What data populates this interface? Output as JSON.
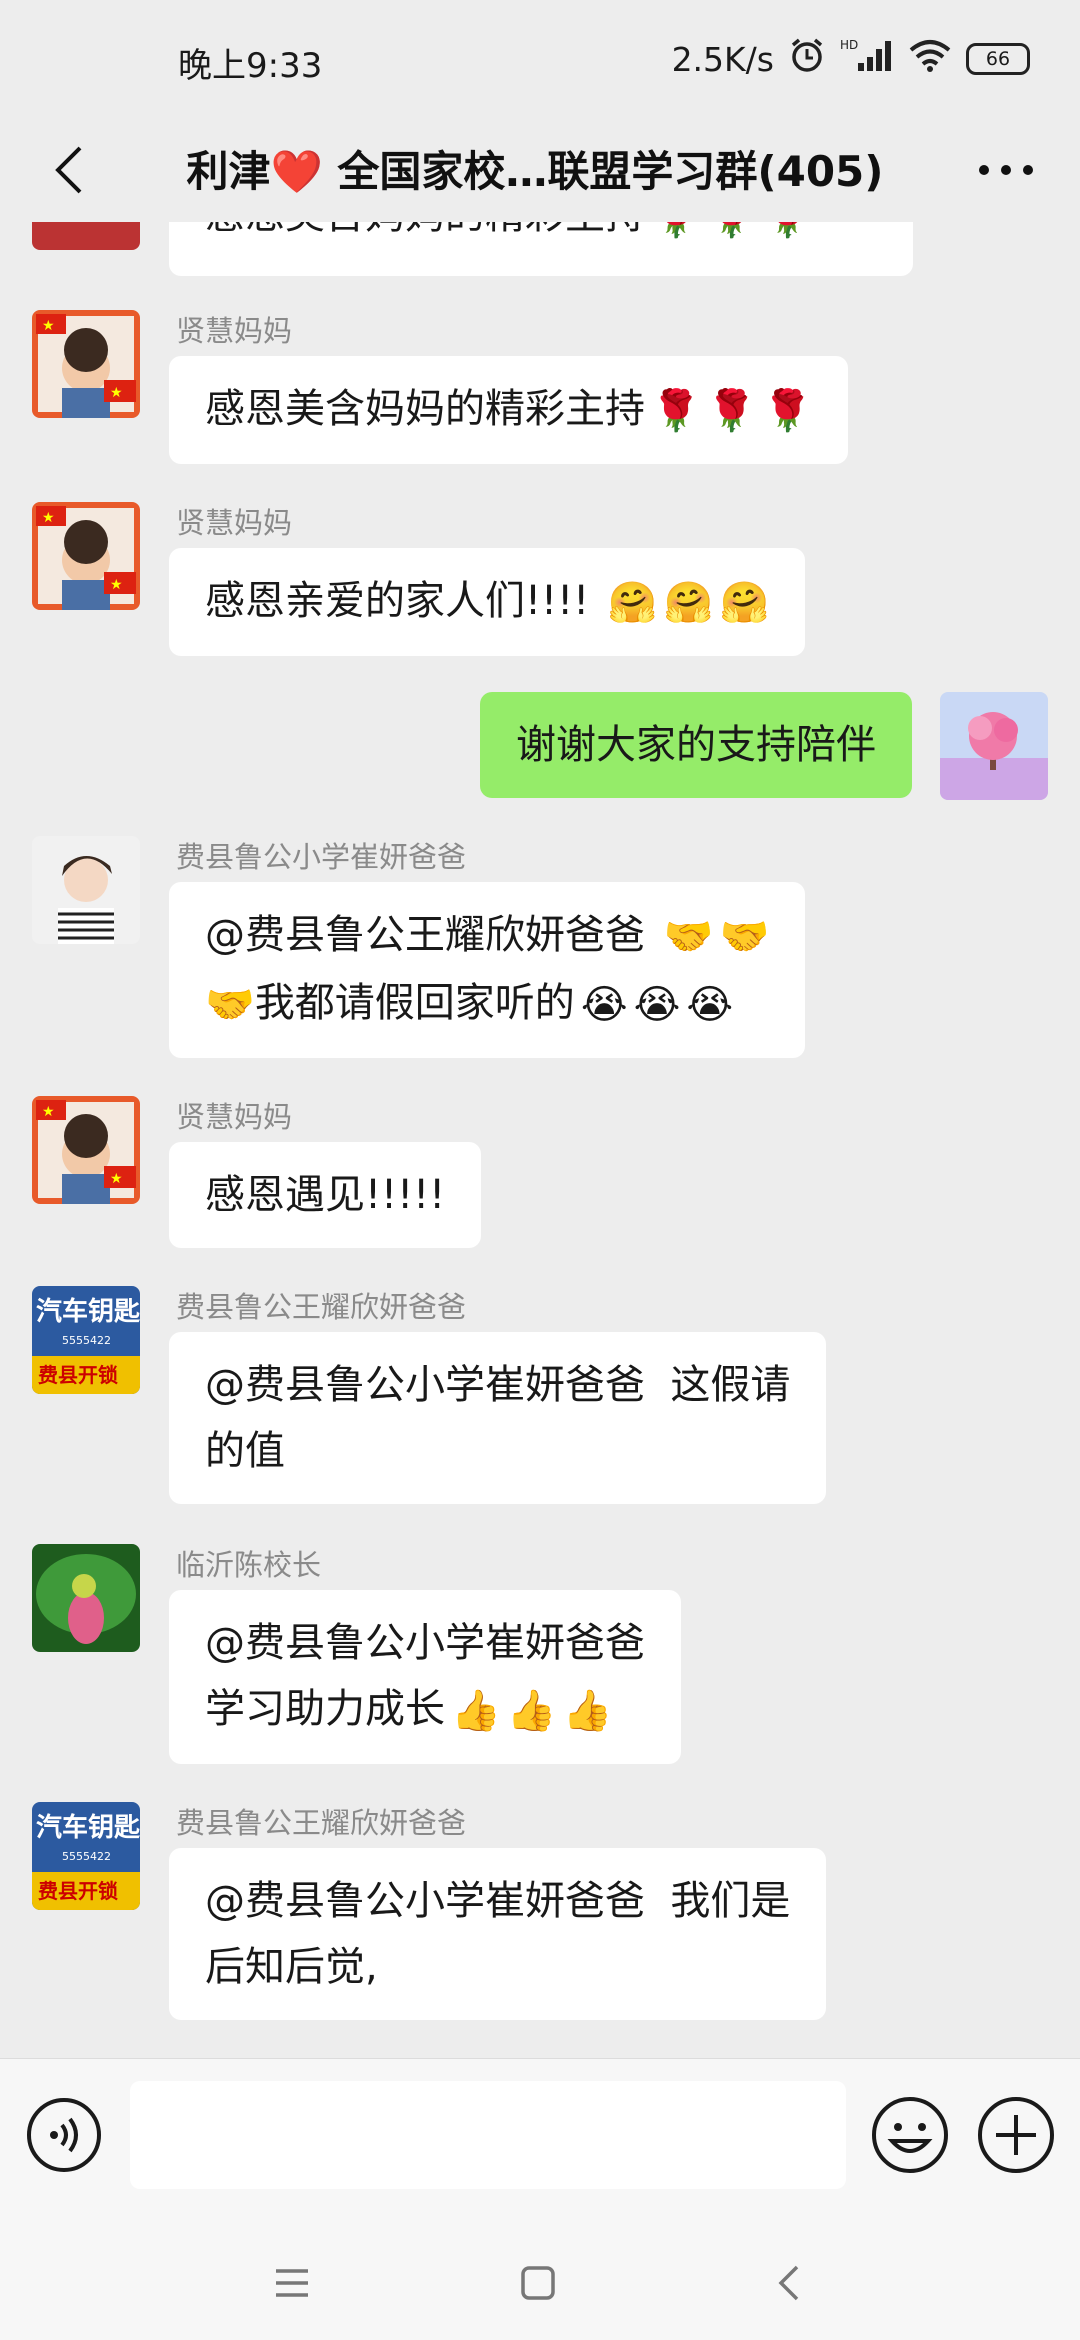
{
  "status_bar": {
    "time": "晚上9:33",
    "network_speed": "2.5K/s",
    "hd_label": "HD",
    "battery": "66"
  },
  "header": {
    "title": "利津❤️ 全国家校…联盟学习群(405)",
    "back_icon": "chevron-left-icon",
    "more_icon": "more-dots-icon"
  },
  "messages": [
    {
      "sender": "",
      "text": "感恩美含妈妈的精彩主持",
      "emojis": [
        "🌹",
        "🌹",
        "🌹"
      ],
      "side": "left",
      "partial": true
    },
    {
      "sender": "贤慧妈妈",
      "text": "感恩美含妈妈的精彩主持",
      "emojis": [
        "🌹",
        "🌹",
        "🌹"
      ],
      "side": "left"
    },
    {
      "sender": "贤慧妈妈",
      "text": "感恩亲爱的家人们!!!! ",
      "emojis": [
        "🤗",
        "🤗",
        "🤗"
      ],
      "side": "left"
    },
    {
      "sender": "",
      "text": "谢谢大家的支持陪伴",
      "emojis": [],
      "side": "right"
    },
    {
      "sender": "费县鲁公小学崔妍爸爸",
      "line1": "@费县鲁公王耀欣妍爸爸 ",
      "line1_emojis": [
        "🤝",
        "🤝"
      ],
      "line2_emojis_before": [
        "🤝"
      ],
      "line2": "我都请假回家听的",
      "line2_emojis": [
        "😭",
        "😭",
        "😭"
      ],
      "side": "left"
    },
    {
      "sender": "贤慧妈妈",
      "text": "感恩遇见!!!!!",
      "emojis": [],
      "side": "left"
    },
    {
      "sender": "费县鲁公王耀欣妍爸爸",
      "line1": "@费县鲁公小学崔妍爸爸  这假请",
      "line2": "的值",
      "side": "left"
    },
    {
      "sender": "临沂陈校长",
      "line1": "@费县鲁公小学崔妍爸爸",
      "line2": "学习助力成长",
      "line2_emojis": [
        "👍",
        "👍",
        "👍"
      ],
      "side": "left"
    },
    {
      "sender": "费县鲁公王耀欣妍爸爸",
      "line1": "@费县鲁公小学崔妍爸爸  我们是",
      "line2": "后知后觉,",
      "side": "left"
    }
  ],
  "avatar_sign": {
    "line1": "汽车钥匙",
    "line2": "5555422",
    "line3": "费县开锁"
  },
  "input_bar": {
    "voice_icon": "voice-icon",
    "emoji_icon": "smiley-icon",
    "plus_icon": "plus-circle-icon",
    "placeholder": ""
  },
  "system_nav": {
    "menu_icon": "menu-icon",
    "home_icon": "home-square-icon",
    "back_icon": "back-triangle-icon"
  },
  "colors": {
    "background": "#ededed",
    "bubble_left": "#ffffff",
    "bubble_right": "#95ec69",
    "sender_text": "#8a8a8a"
  }
}
